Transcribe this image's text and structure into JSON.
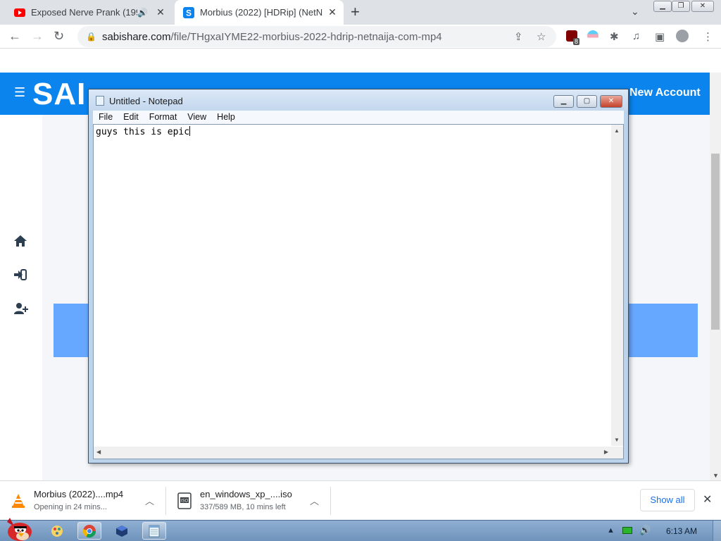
{
  "browser": {
    "tabs": [
      {
        "title": "Exposed Nerve Prank (199",
        "favicon": "youtube-icon",
        "audio": "speaker-icon",
        "close": "✕"
      },
      {
        "title": "Morbius (2022) [HDRip] (NetN",
        "favicon": "sabishare-icon",
        "close": "✕"
      }
    ],
    "new_tab": "+",
    "url_host": "sabishare.com",
    "url_path": "/file/THgxaIYME22-morbius-2022-hdrip-netnaija-com-mp4",
    "extension_badge": "8"
  },
  "site": {
    "logo": "SAI",
    "new_account": "New Account",
    "sidebar_icons": [
      "home-icon",
      "sign-in-icon",
      "user-plus-icon"
    ],
    "brand_color": "#0b84ee",
    "panel_color": "#66a8ff"
  },
  "notepad": {
    "title": "Untitled - Notepad",
    "menu": [
      "File",
      "Edit",
      "Format",
      "View",
      "Help"
    ],
    "text": "guys this is epic"
  },
  "downloads": {
    "items": [
      {
        "name": "Morbius (2022)....mp4",
        "status": "Opening in 24 mins...",
        "icon": "vlc-icon"
      },
      {
        "name": "en_windows_xp_....iso",
        "status": "337/589 MB, 10 mins left",
        "icon": "iso-file-icon"
      }
    ],
    "show_all": "Show all"
  },
  "taskbar": {
    "apps": [
      "paint-icon",
      "chrome-icon",
      "virtualbox-icon",
      "notepad-icon"
    ],
    "clock": "6:13 AM"
  }
}
